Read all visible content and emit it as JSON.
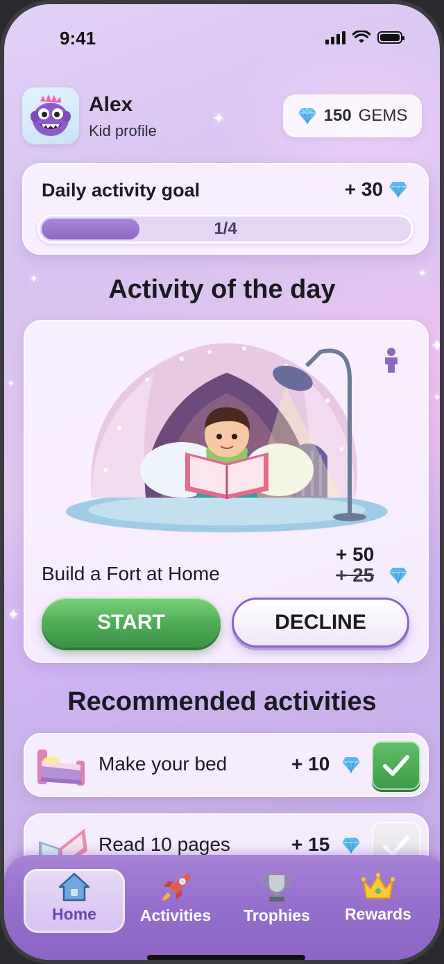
{
  "status": {
    "time": "9:41"
  },
  "profile": {
    "name": "Alex",
    "subtitle": "Kid profile",
    "gems_value": "150",
    "gems_unit": "GEMS"
  },
  "goal": {
    "title": "Daily activity goal",
    "reward": "+ 30",
    "progress_text": "1/4",
    "progress_fraction": 0.25
  },
  "activity_of_day": {
    "heading": "Activity of the day",
    "name": "Build a Fort at Home",
    "reward": "+ 50",
    "old_reward": "+ 25",
    "start_label": "START",
    "decline_label": "DECLINE"
  },
  "recommended": {
    "heading": "Recommended activities",
    "items": [
      {
        "label": "Make your bed",
        "points": "+ 10",
        "done": true
      },
      {
        "label": "Read 10 pages",
        "points": "+ 15",
        "done": false
      }
    ]
  },
  "nav": {
    "items": [
      {
        "label": "Home",
        "icon": "home-icon",
        "active": true
      },
      {
        "label": "Activities",
        "icon": "rocket-icon",
        "active": false
      },
      {
        "label": "Trophies",
        "icon": "trophy-icon",
        "active": false
      },
      {
        "label": "Rewards",
        "icon": "crown-icon",
        "active": false
      }
    ]
  },
  "colors": {
    "accent": "#8d68c4",
    "start_green": "#4fae58",
    "gem_blue": "#5ab6ef"
  }
}
